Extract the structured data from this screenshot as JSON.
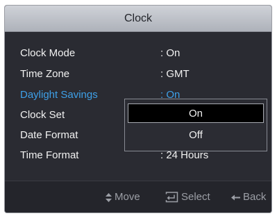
{
  "window": {
    "title": "Clock"
  },
  "menu": {
    "items": [
      {
        "label": "Clock Mode",
        "value": ": On"
      },
      {
        "label": "Time Zone",
        "value": ": GMT"
      },
      {
        "label": "Daylight Savings",
        "value": ": On"
      },
      {
        "label": "Clock Set",
        "value": ""
      },
      {
        "label": "Date Format",
        "value": ""
      },
      {
        "label": "Time Format",
        "value": ": 24 Hours"
      }
    ]
  },
  "popup": {
    "options": [
      {
        "label": "On",
        "selected": true
      },
      {
        "label": "Off",
        "selected": false
      }
    ]
  },
  "footer": {
    "move": {
      "label": "Move",
      "icon": "up-down-arrows-icon"
    },
    "select": {
      "label": "Select",
      "icon": "enter-key-icon"
    },
    "back": {
      "label": "Back",
      "icon": "left-arrow-icon"
    }
  },
  "colors": {
    "highlight": "#3ea0e8",
    "panel": "#2a2b32",
    "title_bar": "#b8bcc4"
  }
}
